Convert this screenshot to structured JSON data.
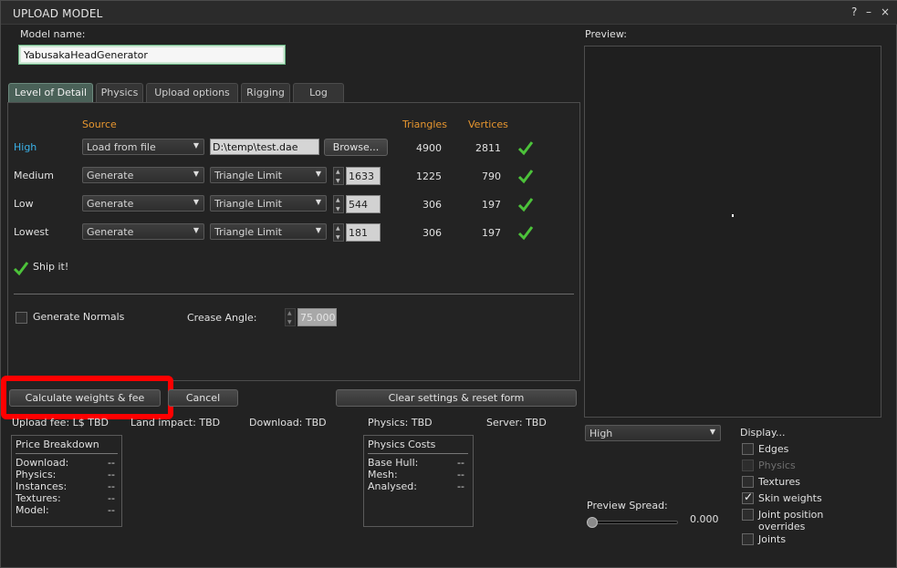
{
  "window": {
    "title": "UPLOAD MODEL",
    "help": "?",
    "minimize": "–",
    "close": "×"
  },
  "model_name": {
    "label": "Model name:",
    "value": "YabusakaHeadGenerator"
  },
  "tabs": [
    {
      "label": "Level of Detail",
      "active": true
    },
    {
      "label": "Physics"
    },
    {
      "label": "Upload options"
    },
    {
      "label": "Rigging"
    },
    {
      "label": "Log"
    }
  ],
  "lod": {
    "headers": {
      "source": "Source",
      "triangles": "Triangles",
      "vertices": "Vertices"
    },
    "rows": [
      {
        "name": "High",
        "source": "Load from file",
        "path": "D:\\temp\\test.dae",
        "button": "Browse...",
        "triangles": "4900",
        "vertices": "2811"
      },
      {
        "name": "Medium",
        "source": "Generate",
        "method": "Triangle Limit",
        "limit": "1633",
        "triangles": "1225",
        "vertices": "790"
      },
      {
        "name": "Low",
        "source": "Generate",
        "method": "Triangle Limit",
        "limit": "544",
        "triangles": "306",
        "vertices": "197"
      },
      {
        "name": "Lowest",
        "source": "Generate",
        "method": "Triangle Limit",
        "limit": "181",
        "triangles": "306",
        "vertices": "197"
      }
    ],
    "ship_it": "Ship it!",
    "generate_normals": "Generate Normals",
    "crease_angle_label": "Crease Angle:",
    "crease_angle_value": "75.000"
  },
  "actions": {
    "calculate": "Calculate weights & fee",
    "cancel": "Cancel",
    "clear": "Clear settings & reset form"
  },
  "stats": {
    "upload_fee": "Upload fee: L$ TBD",
    "land_impact": "Land impact: TBD",
    "download": "Download: TBD",
    "physics": "Physics: TBD",
    "server": "Server: TBD"
  },
  "price_breakdown": {
    "title": "Price Breakdown",
    "rows": [
      {
        "label": "Download:",
        "value": "--"
      },
      {
        "label": "Physics:",
        "value": "--"
      },
      {
        "label": "Instances:",
        "value": "--"
      },
      {
        "label": "Textures:",
        "value": "--"
      },
      {
        "label": "Model:",
        "value": "--"
      }
    ]
  },
  "physics_costs": {
    "title": "Physics Costs",
    "rows": [
      {
        "label": "Base Hull:",
        "value": "--"
      },
      {
        "label": "Mesh:",
        "value": "--"
      },
      {
        "label": "Analysed:",
        "value": "--"
      }
    ]
  },
  "preview": {
    "label": "Preview:",
    "lod_select": "High",
    "spread_label": "Preview Spread:",
    "spread_value": "0.000",
    "spread_fraction": 0.0
  },
  "display": {
    "label": "Display...",
    "options": [
      {
        "label": "Edges",
        "checked": false,
        "enabled": true
      },
      {
        "label": "Physics",
        "checked": false,
        "enabled": false
      },
      {
        "label": "Textures",
        "checked": false,
        "enabled": true
      },
      {
        "label": "Skin weights",
        "checked": true,
        "enabled": true
      },
      {
        "label": "Joint position",
        "label2": "overrides",
        "checked": false,
        "enabled": true
      },
      {
        "label": "Joints",
        "checked": false,
        "enabled": true
      }
    ]
  },
  "colors": {
    "accent_orange": "#e7962f",
    "accent_blue": "#3ab3ea",
    "check_green": "#4cc23a",
    "highlight_red": "#ff0000"
  }
}
